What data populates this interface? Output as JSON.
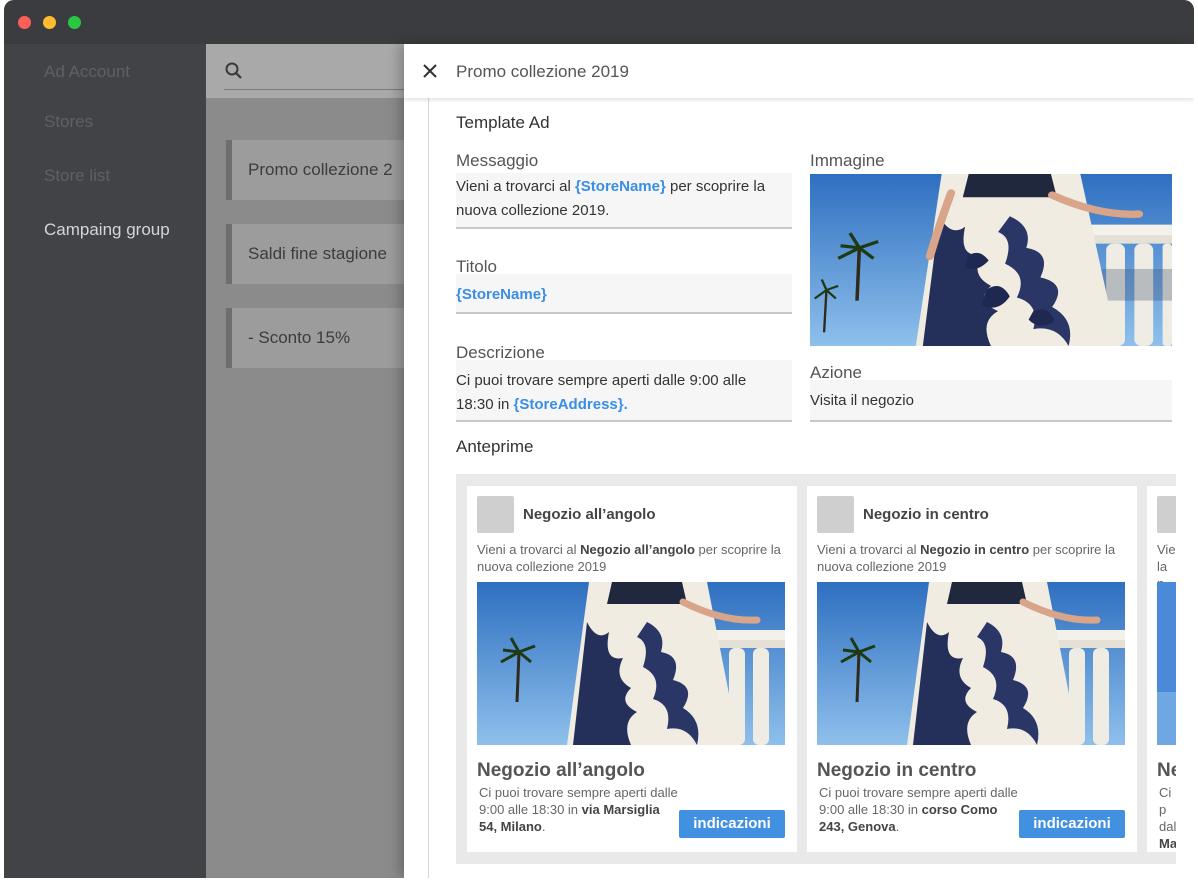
{
  "sidebar": {
    "items": [
      {
        "label": "Ad Account"
      },
      {
        "label": "Stores"
      },
      {
        "label": "Store list"
      },
      {
        "label": "Campaing group"
      }
    ]
  },
  "campaigns": [
    {
      "name": "Promo collezione 2"
    },
    {
      "name": "Saldi fine stagione"
    },
    {
      "name": "- Sconto 15%"
    }
  ],
  "panel": {
    "title": "Promo collezione 2019",
    "section_template": "Template Ad",
    "messaggio": {
      "label": "Messaggio",
      "line1_pre": "Vieni a trovarci al ",
      "tag": "{StoreName}",
      "line1_post": " per scoprire la",
      "line2": "nuova collezione 2019."
    },
    "titolo": {
      "label": "Titolo",
      "value": "{StoreName}"
    },
    "descrizione": {
      "label": "Descrizione",
      "line1": "Ci puoi trovare sempre aperti dalle 9:00 alle",
      "line2_pre": "18:30 in ",
      "tag": "{StoreAddress}."
    },
    "immagine": {
      "label": "Immagine"
    },
    "azione": {
      "label": "Azione",
      "value": "Visita il negozio"
    },
    "section_previews": "Anteprime"
  },
  "previews": [
    {
      "store": "Negozio all’angolo",
      "msg_pre": "Vieni a trovarci al ",
      "msg_bold": "Negozio all’angolo",
      "msg_post": " per scoprire la nuova collezione 2019",
      "headline": "Negozio all’angolo",
      "desc_pre": "Ci puoi trovare sempre aperti dalle 9:00 alle 18:30 in ",
      "desc_bold": "via Marsiglia 54, Milano",
      "desc_post": ".",
      "button": "indicazioni"
    },
    {
      "store": "Negozio in centro",
      "msg_pre": "Vieni a trovarci al ",
      "msg_bold": "Negozio in centro",
      "msg_post": " per scoprire la nuova collezione 2019",
      "headline": "Negozio in centro",
      "desc_pre": "Ci puoi trovare sempre aperti dalle 9:00 alle 18:30 in ",
      "desc_bold": "corso Como 243, Genova",
      "desc_post": ".",
      "button": "indicazioni"
    },
    {
      "store": "",
      "msg_pre": "Vie",
      "msg_bold": "",
      "msg_post": "la n",
      "headline": "Ne",
      "desc_pre": "Ci p dal ",
      "desc_bold": "Ma",
      "desc_post": "",
      "button": ""
    }
  ],
  "colors": {
    "accent": "#3a8ee6",
    "button": "#4290e0",
    "sidebar": "#424347",
    "titlebar": "#3b3c40"
  },
  "icons": [
    "search-icon",
    "close-icon"
  ]
}
